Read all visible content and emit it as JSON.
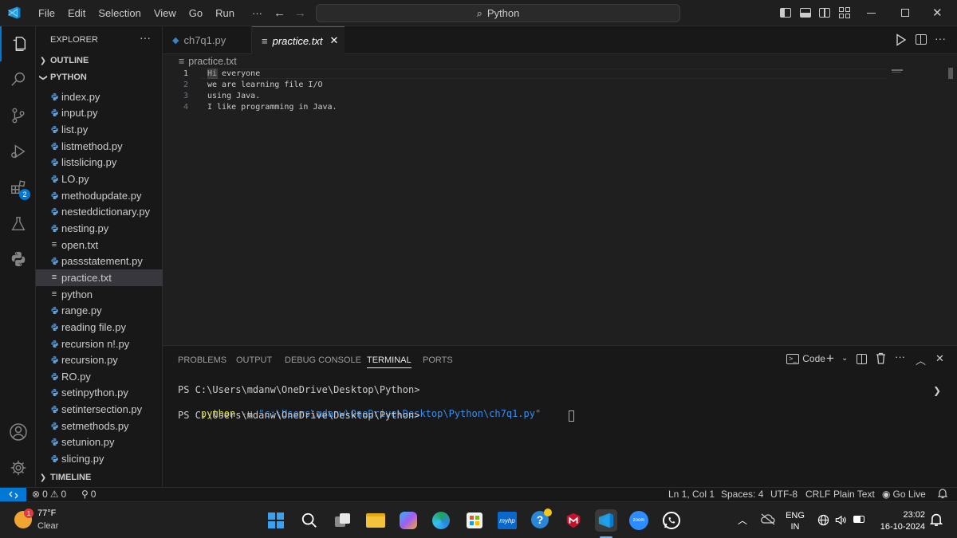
{
  "menu": [
    "File",
    "Edit",
    "Selection",
    "View",
    "Go",
    "Run",
    "···"
  ],
  "command_center": "Python",
  "sidebar": {
    "title": "EXPLORER",
    "more": "···",
    "outline": "OUTLINE",
    "folder": "PYTHON",
    "timeline": "TIMELINE",
    "files": [
      {
        "name": "index.py",
        "kind": "py"
      },
      {
        "name": "input.py",
        "kind": "py"
      },
      {
        "name": "list.py",
        "kind": "py"
      },
      {
        "name": "listmethod.py",
        "kind": "py"
      },
      {
        "name": "listslicing.py",
        "kind": "py"
      },
      {
        "name": "LO.py",
        "kind": "py"
      },
      {
        "name": "methodupdate.py",
        "kind": "py"
      },
      {
        "name": "nesteddictionary.py",
        "kind": "py"
      },
      {
        "name": "nesting.py",
        "kind": "py"
      },
      {
        "name": "open.txt",
        "kind": "txt"
      },
      {
        "name": "passstatement.py",
        "kind": "py"
      },
      {
        "name": "practice.txt",
        "kind": "txt",
        "selected": true
      },
      {
        "name": "python",
        "kind": "txt"
      },
      {
        "name": "range.py",
        "kind": "py"
      },
      {
        "name": "reading file.py",
        "kind": "py"
      },
      {
        "name": "recursion n!.py",
        "kind": "py"
      },
      {
        "name": "recursion.py",
        "kind": "py"
      },
      {
        "name": "RO.py",
        "kind": "py"
      },
      {
        "name": "setinpython.py",
        "kind": "py"
      },
      {
        "name": "setintersection.py",
        "kind": "py"
      },
      {
        "name": "setmethods.py",
        "kind": "py"
      },
      {
        "name": "setunion.py",
        "kind": "py"
      },
      {
        "name": "slicing.py",
        "kind": "py"
      }
    ]
  },
  "activity": {
    "extensions_badge": "2"
  },
  "tabs": [
    {
      "label": "ch7q1.py",
      "active": false
    },
    {
      "label": "practice.txt",
      "active": true
    }
  ],
  "breadcrumb": "practice.txt",
  "editor": {
    "lines": [
      "Hi everyone",
      "we are learning file I/O",
      "using Java.",
      "I like programming in Java."
    ],
    "line_numbers": [
      "1",
      "2",
      "3",
      "4"
    ]
  },
  "panel": {
    "tabs": [
      "PROBLEMS",
      "OUTPUT",
      "DEBUG CONSOLE",
      "TERMINAL",
      "PORTS"
    ],
    "active_tab": "TERMINAL",
    "terminal_label": "Code",
    "terminal": {
      "line1": "PS C:\\Users\\mdanw\\OneDrive\\Desktop\\Python>",
      "cmd": "python",
      "flag": "-u",
      "arg": "\"c:\\Users\\mdanw\\OneDrive\\Desktop\\Python\\ch7q1.py\"",
      "line3": "PS C:\\Users\\mdanw\\OneDrive\\Desktop\\Python>"
    }
  },
  "status": {
    "errors": "0",
    "warnings": "0",
    "ports": "0",
    "position": "Ln 1, Col 1",
    "spaces": "Spaces: 4",
    "encoding": "UTF-8",
    "eol": "CRLF",
    "language": "Plain Text",
    "golive": "Go Live"
  },
  "taskbar": {
    "weather_temp": "77°F",
    "weather_desc": "Clear",
    "weather_badge": "1",
    "lang1": "ENG",
    "lang2": "IN",
    "time": "23:02",
    "date": "16-10-2024"
  },
  "colors": {
    "accent": "#0078d4",
    "python_blue": "#3b82c4"
  }
}
